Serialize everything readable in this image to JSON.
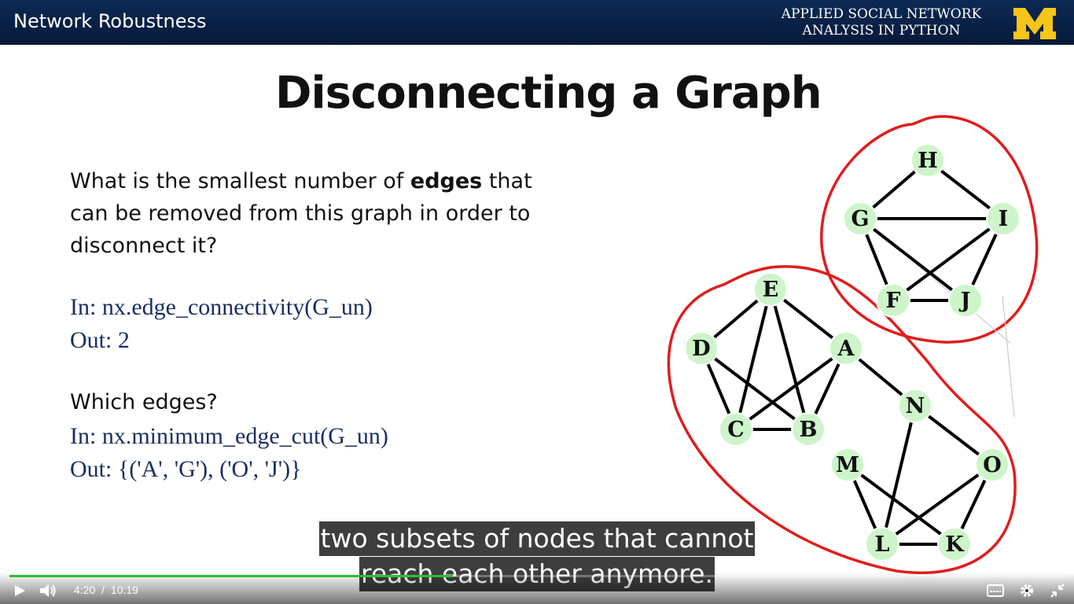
{
  "header": {
    "title": "Network Robustness",
    "course_line1": "APPLIED SOCIAL NETWORK",
    "course_line2": "ANALYSIS IN PYTHON",
    "logo_letter": "M"
  },
  "slide": {
    "title": "Disconnecting a Graph",
    "question_part1": "What is the smallest number of ",
    "question_bold": "edges",
    "question_part2": " that can be removed from this graph in order to disconnect it?",
    "code1_in": "In: nx.edge_connectivity(G_un)",
    "code1_out": "Out: 2",
    "which": "Which edges?",
    "code2_in": "In: nx.minimum_edge_cut(G_un)",
    "code2_out": "Out: {('A', 'G'), ('O', 'J')}"
  },
  "graph": {
    "nodes": [
      "H",
      "G",
      "I",
      "F",
      "J",
      "E",
      "D",
      "A",
      "N",
      "C",
      "B",
      "M",
      "O",
      "L",
      "K"
    ],
    "edges": [
      [
        "H",
        "G"
      ],
      [
        "H",
        "I"
      ],
      [
        "G",
        "I"
      ],
      [
        "G",
        "J"
      ],
      [
        "G",
        "F"
      ],
      [
        "I",
        "F"
      ],
      [
        "I",
        "J"
      ],
      [
        "F",
        "J"
      ],
      [
        "E",
        "D"
      ],
      [
        "E",
        "A"
      ],
      [
        "E",
        "C"
      ],
      [
        "E",
        "B"
      ],
      [
        "D",
        "C"
      ],
      [
        "D",
        "B"
      ],
      [
        "A",
        "C"
      ],
      [
        "A",
        "B"
      ],
      [
        "C",
        "B"
      ],
      [
        "A",
        "N"
      ],
      [
        "N",
        "O"
      ],
      [
        "N",
        "L"
      ],
      [
        "M",
        "L"
      ],
      [
        "M",
        "K"
      ],
      [
        "O",
        "L"
      ],
      [
        "O",
        "K"
      ],
      [
        "L",
        "K"
      ],
      [
        "A",
        "G"
      ],
      [
        "O",
        "J"
      ]
    ],
    "node_fill": "#cdf5c9",
    "circle_color": "#e01d1d"
  },
  "captions": {
    "line1": "two subsets of nodes that cannot",
    "line2": "reach each other anymore."
  },
  "player": {
    "current_time": "4:20",
    "separator": "/",
    "duration": "10:19",
    "progress": 0.42,
    "accent": "#2ebf2e"
  }
}
